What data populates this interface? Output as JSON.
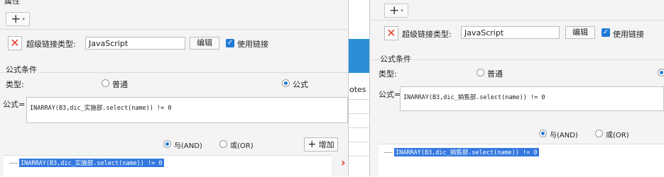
{
  "left": {
    "section_title_partial": "属性",
    "hyperlink_type_label": "超级链接类型:",
    "hyperlink_type_value": "JavaScript",
    "edit_button": "编辑",
    "use_link_label": "使用链接",
    "formula_condition_title": "公式条件",
    "type_label": "类型:",
    "radio_normal": "普通",
    "radio_formula": "公式",
    "formula_label": "公式=",
    "formula_text": "INARRAY(B3,dic_实施部.select(name)) != 0",
    "and_label": "与(AND)",
    "or_label": "或(OR)",
    "add_button": "增加",
    "list_item": "INARRAY(B3,dic_实施部.select(name)) != 0"
  },
  "middle": {
    "partial_text": "otes"
  },
  "right": {
    "hyperlink_type_label": "超级链接类型:",
    "hyperlink_type_value": "JavaScript",
    "edit_button": "编辑",
    "use_link_label": "使用链接",
    "formula_condition_title": "公式条件",
    "type_label": "类型:",
    "radio_normal": "普通",
    "formula_label": "公式=",
    "formula_text": "INARRAY(B3,dic_销售部.select(name)) != 0",
    "and_label": "与(AND)",
    "or_label": "或(OR)",
    "list_item": "INARRAY(B3,dic_销售部.select(name)) != 0"
  },
  "colors": {
    "selection": "#3478e0",
    "delete": "#e23b2c",
    "checkbox": "#1f7ad6"
  }
}
